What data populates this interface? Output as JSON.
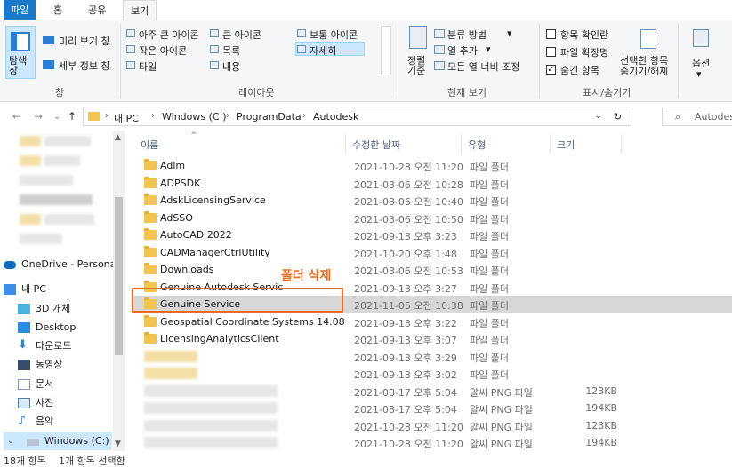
{
  "ribbon_tabs": [
    "파일",
    "홈",
    "공유",
    "보기"
  ],
  "ribbon": {
    "pane_group": {
      "nav_pane_label": "탐색\n창",
      "preview_label": "미리 보기 창",
      "details_label": "세부 정보 창",
      "group_label": "창"
    },
    "layout_group": {
      "items": [
        "아주 큰 아이콘",
        "큰 아이콘",
        "보통 아이콘",
        "작은 아이콘",
        "목록",
        "자세히",
        "타일",
        "내용"
      ],
      "selected": "자세히",
      "group_label": "레이아웃"
    },
    "current_view_group": {
      "sort_label": "정렬\n기준",
      "group_by": "분류 방법",
      "add_column": "열 추가",
      "fit_columns": "모든 열 너비 조정",
      "group_label": "현재 보기"
    },
    "show_hide_group": {
      "item_checkboxes": "항목 확인란",
      "file_extensions": "파일 확장명",
      "hidden_items": "숨긴 항목",
      "hide_selected": "선택한 항목\n숨기기/해제",
      "options": "옵션",
      "group_label": "표시/숨기기"
    }
  },
  "address": {
    "breadcrumbs": [
      "내 PC",
      "Windows (C:)",
      "ProgramData",
      "Autodesk"
    ],
    "search_placeholder": "Autodesk"
  },
  "nav_pane": {
    "items": [
      "OneDrive - Personal",
      "내 PC",
      "3D 개체",
      "Desktop",
      "다운로드",
      "동영상",
      "문서",
      "사진",
      "음악",
      "Windows (C:)"
    ]
  },
  "columns": [
    "이름",
    "수정한 날짜",
    "유형",
    "크기"
  ],
  "files": [
    {
      "name": "Adlm",
      "date": "2021-10-28 오전 11:20",
      "type": "파일 폴더",
      "size": ""
    },
    {
      "name": "ADPSDK",
      "date": "2021-03-06 오전 10:28",
      "type": "파일 폴더",
      "size": ""
    },
    {
      "name": "AdskLicensingService",
      "date": "2021-03-06 오전 10:40",
      "type": "파일 폴더",
      "size": ""
    },
    {
      "name": "AdSSO",
      "date": "2021-03-06 오전 10:50",
      "type": "파일 폴더",
      "size": ""
    },
    {
      "name": "AutoCAD 2022",
      "date": "2021-09-13 오후 3:23",
      "type": "파일 폴더",
      "size": ""
    },
    {
      "name": "CADManagerCtrlUtility",
      "date": "2021-10-20 오후 1:48",
      "type": "파일 폴더",
      "size": ""
    },
    {
      "name": "Downloads",
      "date": "2021-03-06 오전 10:53",
      "type": "파일 폴더",
      "size": ""
    },
    {
      "name": "Genuine Autodesk Servic",
      "date": "2021-09-13 오후 3:27",
      "type": "파일 폴더",
      "size": ""
    },
    {
      "name": "Genuine Service",
      "date": "2021-11-05 오전 10:38",
      "type": "파일 폴더",
      "size": "",
      "selected": true
    },
    {
      "name": "Geospatial Coordinate Systems 14.08",
      "date": "2021-09-13 오후 3:22",
      "type": "파일 폴더",
      "size": ""
    },
    {
      "name": "LicensingAnalyticsClient",
      "date": "2021-09-13 오후 3:07",
      "type": "파일 폴더",
      "size": ""
    },
    {
      "name": "",
      "date": "2021-09-13 오후 3:29",
      "type": "파일 폴더",
      "size": ""
    },
    {
      "name": "",
      "date": "2021-09-13 오후 3:02",
      "type": "파일 폴더",
      "size": ""
    },
    {
      "name": "",
      "date": "2021-08-17 오후 5:04",
      "type": "알씨 PNG 파일",
      "size": "123KB"
    },
    {
      "name": "",
      "date": "2021-08-17 오후 5:04",
      "type": "알씨 PNG 파일",
      "size": "194KB"
    },
    {
      "name": "",
      "date": "2021-10-28 오전 11:20",
      "type": "알씨 PNG 파일",
      "size": "123KB"
    },
    {
      "name": "",
      "date": "2021-10-28 오전 11:20",
      "type": "알씨 PNG 파일",
      "size": "194KB"
    }
  ],
  "annotation": "폴더 삭제",
  "status": {
    "count": "18개 항목",
    "selected": "1개 항목 선택함"
  },
  "colors": {
    "accent": "#1979ca",
    "highlight": "#f06a1e",
    "selected_row": "#d8d8d8",
    "folder": "#f4c54c"
  }
}
